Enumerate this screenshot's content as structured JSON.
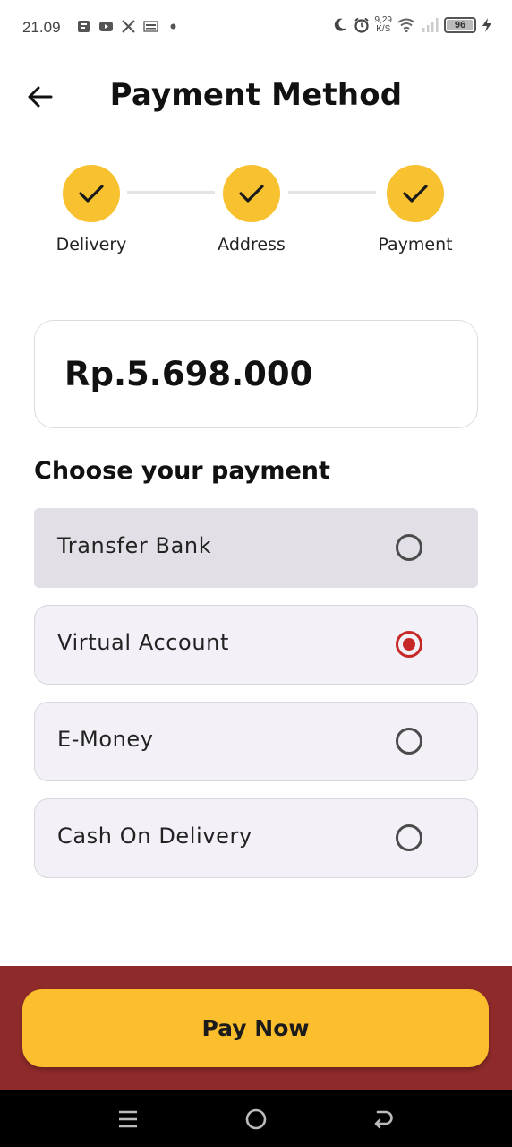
{
  "status_bar": {
    "time": "21.09",
    "left_icons": [
      "document-icon",
      "youtube-icon",
      "x-icon",
      "kuk-icon",
      "dot-icon"
    ],
    "speed_value": "9,29",
    "speed_unit": "K/S",
    "battery": "96",
    "battery_level_percent": 96
  },
  "header": {
    "title": "Payment Method",
    "back_icon": "arrow-left-icon"
  },
  "stepper": {
    "steps": [
      {
        "label": "Delivery",
        "done": true
      },
      {
        "label": "Address",
        "done": true
      },
      {
        "label": "Payment",
        "done": true
      }
    ]
  },
  "amount": {
    "value": "Rp.5.698.000"
  },
  "payment": {
    "heading": "Choose your payment",
    "options": [
      {
        "label": "Transfer Bank",
        "selected": false
      },
      {
        "label": "Virtual Account",
        "selected": true
      },
      {
        "label": "E-Money",
        "selected": false
      },
      {
        "label": "Cash On Delivery",
        "selected": false
      }
    ]
  },
  "actions": {
    "pay_label": "Pay Now"
  },
  "nav_bar": {
    "icons": [
      "menu-icon",
      "home-icon",
      "back-icon"
    ]
  },
  "colors": {
    "accent": "#f7c12f",
    "bottom_bar": "#8e2a2a",
    "radio_selected": "#c62828"
  }
}
